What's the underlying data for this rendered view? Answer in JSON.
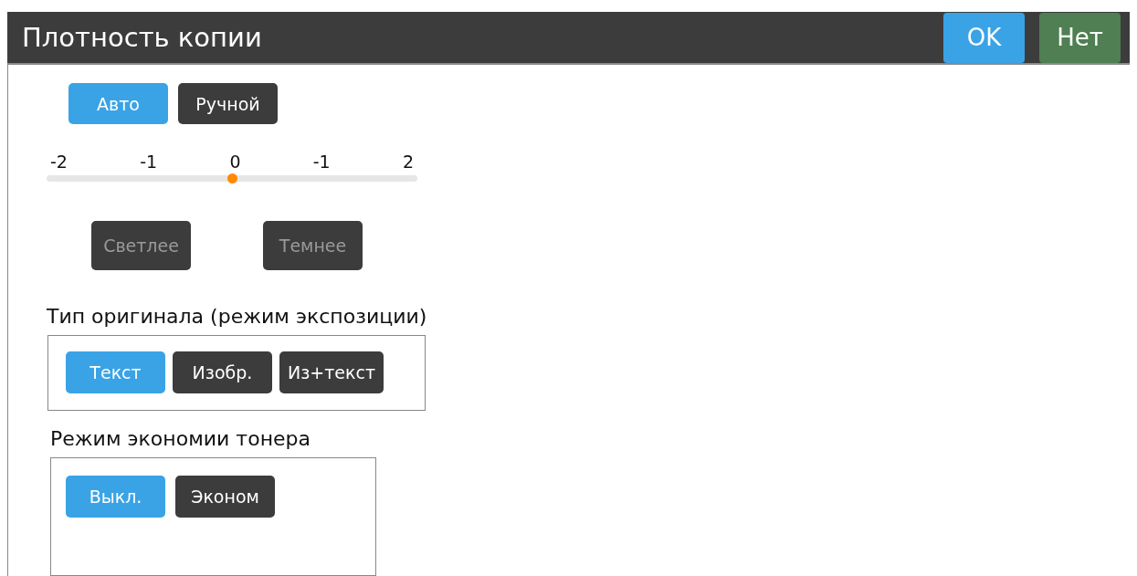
{
  "window": {
    "title": "Плотность копии"
  },
  "header_buttons": [
    {
      "label": "OK",
      "kind": "primary"
    },
    {
      "label": "Нет",
      "kind": "cancel"
    }
  ],
  "mode_buttons": [
    {
      "label": "Авто",
      "selected": true
    },
    {
      "label": "Ручной",
      "selected": false
    }
  ],
  "density_slider": {
    "ticks": [
      "-2",
      "-1",
      "0",
      "-1",
      "2"
    ],
    "level": 0.5
  },
  "adjust_buttons": [
    {
      "label": "Светлее",
      "disabled": true
    },
    {
      "label": "Темнее",
      "disabled": true
    }
  ],
  "original_type": {
    "label": "Тип оригинала (режим экспозиции)",
    "options": [
      {
        "label": "Текст",
        "selected": true
      },
      {
        "label": "Изобр.",
        "selected": false
      },
      {
        "label": "Из+текст",
        "selected": false
      }
    ]
  },
  "toner_save": {
    "label": "Режим экономии тонера",
    "options": [
      {
        "label": "Выкл.",
        "selected": true
      },
      {
        "label": "Эконом",
        "selected": false
      }
    ]
  }
}
